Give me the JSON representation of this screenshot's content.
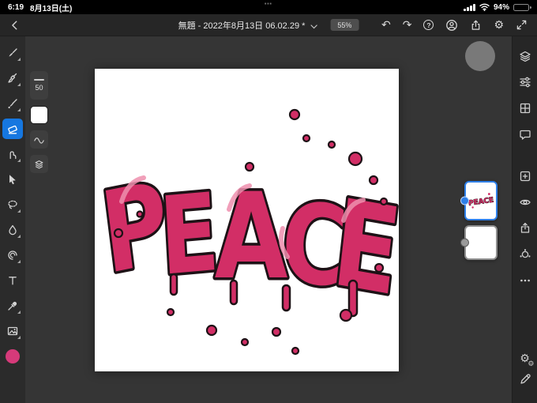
{
  "status_bar": {
    "time": "6:19",
    "date": "8月13日(土)",
    "battery_percent": "94%",
    "multitask_indicator": "⋯"
  },
  "toolbar": {
    "title": "無題 - 2022年8月13日 06.02.29 *",
    "zoom": "55%",
    "glyphs": {
      "undo": "↶",
      "redo": "↷",
      "help": "?",
      "gear": "⚙"
    },
    "icon_names": [
      "back-chevron-icon",
      "chevron-down-icon",
      "undo-icon",
      "redo-icon",
      "help-icon",
      "account-icon",
      "share-icon",
      "gear-icon",
      "fullscreen-icon"
    ]
  },
  "left_toolbar": {
    "tools": [
      "pixel-brush",
      "live-brush",
      "vector-brush",
      "eraser",
      "smudge",
      "move",
      "lasso",
      "fill",
      "liquify",
      "text",
      "eyedropper",
      "place-image"
    ],
    "active_tool": "eraser",
    "current_color": "#d63a7a"
  },
  "tool_options": {
    "brush_size": "50",
    "selected_color": "#ffffff"
  },
  "canvas": {
    "word": "PEACE",
    "letters": [
      "P",
      "E",
      "A",
      "C",
      "E"
    ],
    "art_color": "#d22e66",
    "art_outline": "#1d1216",
    "art_highlight": "#ef8fae"
  },
  "layers_panel": {
    "layers": [
      {
        "name": "artwork-layer",
        "selected": true
      },
      {
        "name": "background-layer",
        "selected": false
      }
    ]
  },
  "right_toolbar": {
    "gear_glyph": "⚙",
    "icon_names": [
      "layers-icon",
      "adjustments-icon",
      "grid-icon",
      "comment-icon",
      "add-layer-icon",
      "visibility-icon",
      "export-icon",
      "effects-icon",
      "more-icon",
      "app-settings-icon",
      "edit-toolbar-icon"
    ]
  },
  "colors": {
    "accent_blue": "#1677e0",
    "selection_blue": "#2e7fe8",
    "toolbar_bg": "#262626",
    "workspace_bg": "#353535"
  }
}
